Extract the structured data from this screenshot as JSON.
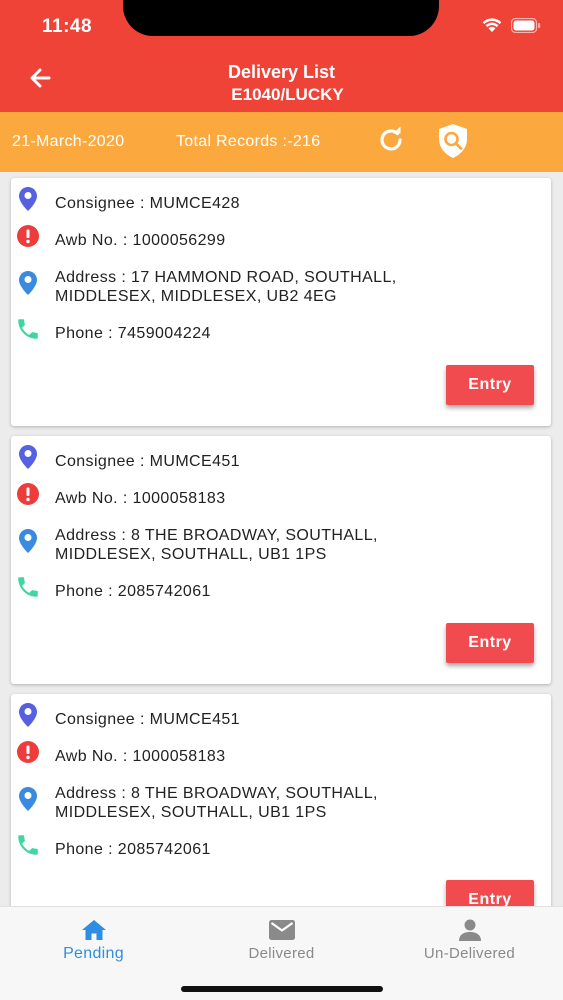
{
  "status": {
    "time": "11:48"
  },
  "header": {
    "title": "Delivery List",
    "subtitle": "E1040/LUCKY"
  },
  "info": {
    "date": "21-March-2020",
    "total": "Total Records :-216"
  },
  "colors": {
    "header": "#ef4338",
    "info_bar": "#fba93e",
    "entry_button": "#f24b4f",
    "active_tab": "#2f8ee0"
  },
  "deliveries": [
    {
      "consignee": "Consignee : MUMCE428",
      "awb": "Awb No. : 1000056299",
      "address_line1": "Address : 17 HAMMOND ROAD, SOUTHALL,",
      "address_line2": "MIDDLESEX, MIDDLESEX, UB2 4EG",
      "phone": "Phone : 7459004224",
      "entry_label": "Entry"
    },
    {
      "consignee": "Consignee : MUMCE451",
      "awb": "Awb No. : 1000058183",
      "address_line1": "Address : 8 THE BROADWAY, SOUTHALL,",
      "address_line2": "MIDDLESEX, SOUTHALL, UB1 1PS",
      "phone": "Phone : 2085742061",
      "entry_label": "Entry"
    },
    {
      "consignee": "Consignee : MUMCE451",
      "awb": "Awb No. : 1000058183",
      "address_line1": "Address : 8 THE BROADWAY, SOUTHALL,",
      "address_line2": "MIDDLESEX, SOUTHALL, UB1 1PS",
      "phone": "Phone : 2085742061",
      "entry_label": "Entry"
    }
  ],
  "tabs": [
    {
      "label": "Pending",
      "icon": "home-icon",
      "active": true
    },
    {
      "label": "Delivered",
      "icon": "mail-icon",
      "active": false
    },
    {
      "label": "Un-Delivered",
      "icon": "person-icon",
      "active": false
    }
  ]
}
